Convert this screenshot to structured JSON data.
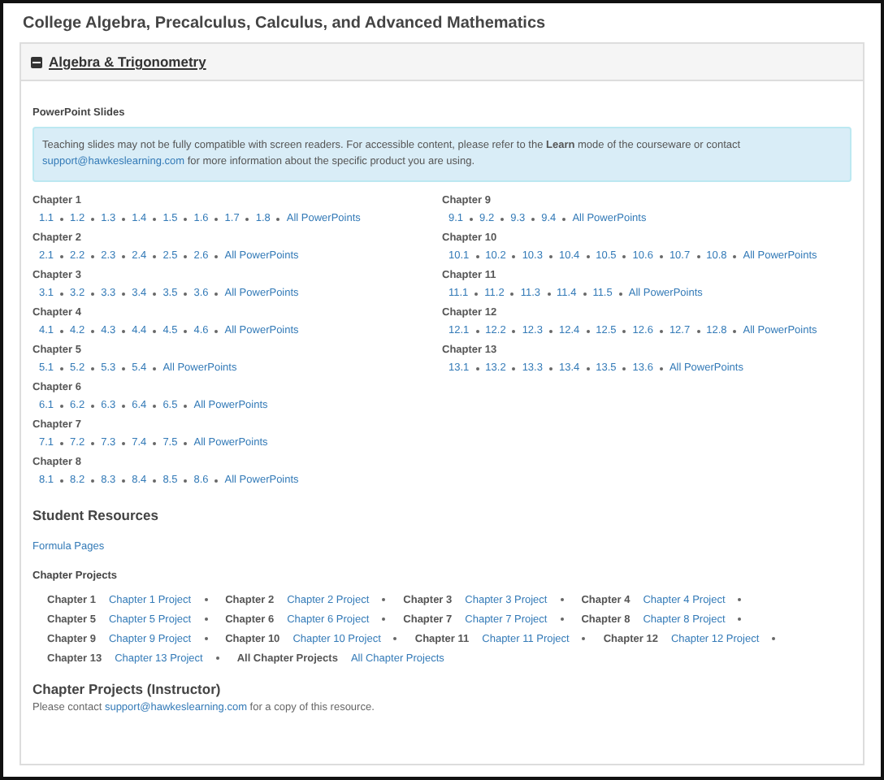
{
  "page_title": "College Algebra, Precalculus, Calculus, and Advanced Mathematics",
  "section": {
    "title": "Algebra & Trigonometry",
    "expanded": true
  },
  "powerpoint": {
    "heading": "PowerPoint Slides",
    "notice": {
      "text": "Teaching slides may not be fully compatible with screen readers. For accessible content, please refer to the **Learn** mode of the courseware or contact",
      "email": "support@hawkeslearning.com",
      "after": "for more information about the specific product you are using."
    },
    "columns": [
      [
        {
          "chapter": "Chapter 1",
          "links": [
            "1.1",
            "1.2",
            "1.3",
            "1.4",
            "1.5",
            "1.6",
            "1.7",
            "1.8",
            "All PowerPoints"
          ]
        },
        {
          "chapter": "Chapter 2",
          "links": [
            "2.1",
            "2.2",
            "2.3",
            "2.4",
            "2.5",
            "2.6",
            "All PowerPoints"
          ]
        },
        {
          "chapter": "Chapter 3",
          "links": [
            "3.1",
            "3.2",
            "3.3",
            "3.4",
            "3.5",
            "3.6",
            "All PowerPoints"
          ]
        },
        {
          "chapter": "Chapter 4",
          "links": [
            "4.1",
            "4.2",
            "4.3",
            "4.4",
            "4.5",
            "4.6",
            "All PowerPoints"
          ]
        },
        {
          "chapter": "Chapter 5",
          "links": [
            "5.1",
            "5.2",
            "5.3",
            "5.4",
            "All PowerPoints"
          ]
        },
        {
          "chapter": "Chapter 6",
          "links": [
            "6.1",
            "6.2",
            "6.3",
            "6.4",
            "6.5",
            "All PowerPoints"
          ]
        },
        {
          "chapter": "Chapter 7",
          "links": [
            "7.1",
            "7.2",
            "7.3",
            "7.4",
            "7.5",
            "All PowerPoints"
          ]
        },
        {
          "chapter": "Chapter 8",
          "links": [
            "8.1",
            "8.2",
            "8.3",
            "8.4",
            "8.5",
            "8.6",
            "All PowerPoints"
          ]
        }
      ],
      [
        {
          "chapter": "Chapter 9",
          "links": [
            "9.1",
            "9.2",
            "9.3",
            "9.4",
            "All PowerPoints"
          ]
        },
        {
          "chapter": "Chapter 10",
          "links": [
            "10.1",
            "10.2",
            "10.3",
            "10.4",
            "10.5",
            "10.6",
            "10.7",
            "10.8",
            "All PowerPoints"
          ]
        },
        {
          "chapter": "Chapter 11",
          "links": [
            "11.1",
            "11.2",
            "11.3",
            "11.4",
            "11.5",
            "All PowerPoints"
          ]
        },
        {
          "chapter": "Chapter 12",
          "links": [
            "12.1",
            "12.2",
            "12.3",
            "12.4",
            "12.5",
            "12.6",
            "12.7",
            "12.8",
            "All PowerPoints"
          ]
        },
        {
          "chapter": "Chapter 13",
          "links": [
            "13.1",
            "13.2",
            "13.3",
            "13.4",
            "13.5",
            "13.6",
            "All PowerPoints"
          ]
        }
      ]
    ]
  },
  "student_resources": {
    "heading": "Student Resources",
    "formula_link": "Formula Pages",
    "projects_heading": "Chapter Projects",
    "project_rows": [
      [
        {
          "label": "Chapter 1",
          "link": "Chapter 1 Project"
        },
        {
          "label": "Chapter 2",
          "link": "Chapter 2 Project"
        },
        {
          "label": "Chapter 3",
          "link": "Chapter 3 Project"
        },
        {
          "label": "Chapter 4",
          "link": "Chapter 4 Project"
        }
      ],
      [
        {
          "label": "Chapter 5",
          "link": "Chapter 5 Project"
        },
        {
          "label": "Chapter 6",
          "link": "Chapter 6 Project"
        },
        {
          "label": "Chapter 7",
          "link": "Chapter 7 Project"
        },
        {
          "label": "Chapter 8",
          "link": "Chapter 8 Project"
        }
      ],
      [
        {
          "label": "Chapter 9",
          "link": "Chapter 9 Project"
        },
        {
          "label": "Chapter 10",
          "link": "Chapter 10 Project"
        },
        {
          "label": "Chapter 11",
          "link": "Chapter 11 Project"
        },
        {
          "label": "Chapter 12",
          "link": "Chapter 12 Project"
        }
      ],
      [
        {
          "label": "Chapter 13",
          "link": "Chapter 13 Project"
        },
        {
          "label": "All Chapter Projects",
          "link": "All Chapter Projects"
        }
      ]
    ]
  },
  "instructor": {
    "heading": "Chapter Projects (Instructor)",
    "before": "Please contact",
    "email": "support@hawkeslearning.com",
    "after": "for a copy of this resource."
  }
}
